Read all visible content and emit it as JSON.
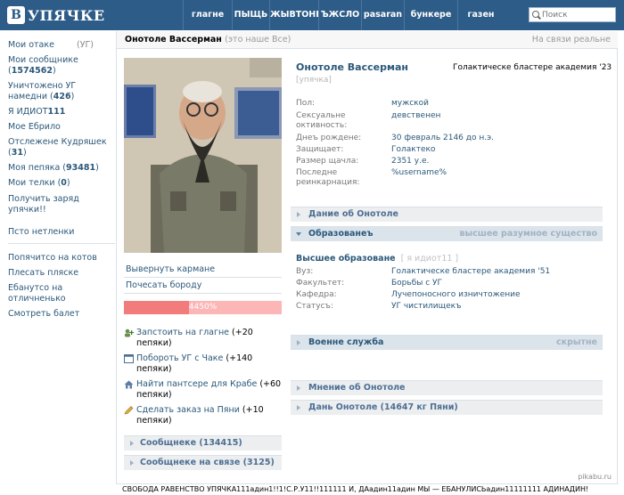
{
  "header": {
    "logo_mark": "В",
    "logo_text": "УПЯЧКЕ",
    "nav": [
      "глагне",
      "ПЫЩЬ",
      "ЖЫВТОНЕ",
      "ЪЖСЛО",
      "pasaran",
      "бункере",
      "газен"
    ],
    "search_placeholder": "Поиск"
  },
  "sidebar": {
    "items": [
      {
        "label": "Мои отаке",
        "tag": "(УГ)"
      },
      {
        "label": "Мои сообщнике (",
        "count": "1574562",
        "end": ")"
      },
      {
        "label": "Уничтожено УГ намедни (",
        "count": "426",
        "end": ")"
      },
      {
        "label": "Я ИДИОТ",
        "count": "111",
        "end": ""
      },
      {
        "label": "Мое Ебрило"
      },
      {
        "label": "Отслежене Кудряшек (",
        "count": "31",
        "end": ")"
      },
      {
        "label": "Моя пепяка (",
        "count": "93481",
        "end": ")"
      },
      {
        "label": "Мои телки (",
        "count": "0",
        "end": ")"
      },
      {
        "label": "Получить заряд упячки!!"
      },
      {
        "label": "Псто нетленки"
      }
    ],
    "bottom": [
      "Попячитсо на котов",
      "Плесать пляске",
      "Ебанутсо на отличненько",
      "Смотреть балет"
    ]
  },
  "profile": {
    "title_name": "Онотоле Вассерман",
    "title_sub": "(это наше Все)",
    "online": "На связи реальне",
    "name": "Онотоле Вассерман",
    "academy": "Голактическе бластере академия '23",
    "status": "[упячка]",
    "info": [
      {
        "label": "Пол:",
        "value": "мужской"
      },
      {
        "label": "Сексуальне октивность:",
        "value": "девственен"
      },
      {
        "label": "Днеъ рождене:",
        "value": "30 февраль 2146 до н.э."
      },
      {
        "label": "Защищает:",
        "value": "Голактеко"
      },
      {
        "label": "Размер щачла:",
        "value": "2351 у.е."
      },
      {
        "label": "Последне реинкарнация:",
        "value": "%username%"
      }
    ],
    "actions": [
      "Вывернуть кармане",
      "Почесать бороду"
    ],
    "rating": {
      "label": "4450%",
      "fill_fraction": 0.41
    },
    "gifts": [
      {
        "icon": "person-add-icon",
        "link": "Запстоить на глагне",
        "rest": " (+20 пепяки)"
      },
      {
        "icon": "window-icon",
        "link": "Побороть УГ с Чаке",
        "rest": " (+140 пепяки)"
      },
      {
        "icon": "house-icon",
        "link": "Найти пантсере для Крабе",
        "rest": " (+60 пепяки)"
      },
      {
        "icon": "pencil-icon",
        "link": "Сделать заказ на Пяни",
        "rest": " (+10 пепяки)"
      }
    ],
    "left_boxes": [
      "Сообщнеке (134415)",
      "Сообщнеке на связе (3125)"
    ],
    "sections": {
      "data": "Дание об Онотоле",
      "education": "Образованеъ",
      "education_extra": "высшее разумное существо",
      "military": "Военне служба",
      "military_extra": "скрытне",
      "opinion": "Мнение об Онотоле",
      "day": "Дань Онотоле (14647 кг Пяни)"
    },
    "education": {
      "title": "Высшее образоване",
      "tag": "[ я идиот11 ]",
      "rows": [
        {
          "label": "Вуз:",
          "value": "Голактическе бластере академия '51"
        },
        {
          "label": "Факультет:",
          "value": "Борьбы с УГ"
        },
        {
          "label": "Кафедра:",
          "value": "Лучепоносного изничтожение"
        },
        {
          "label": "Статусъ:",
          "value": "УГ чистилищекъ"
        }
      ]
    }
  },
  "footer": "СВОБОДА РАВЕНСТВО УПЯЧКА111адин1!!1!С.Р.У11!!111111 И, ДАадин11адин МЫ — ЕБАНУЛИСЬадин11111111 АДИНАДИН!",
  "watermark": "pikabu.ru",
  "colors": {
    "header": "#2e5c88",
    "link": "#2b587a",
    "rating_fill": "#f27b7b",
    "rating_bg": "#fcb6b6"
  }
}
